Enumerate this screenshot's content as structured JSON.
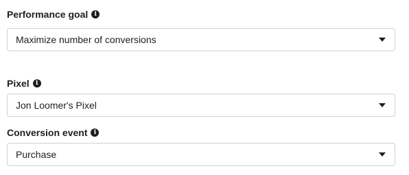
{
  "performance_goal": {
    "label": "Performance goal",
    "selected": "Maximize number of conversions"
  },
  "pixel": {
    "label": "Pixel",
    "selected": "Jon Loomer's Pixel"
  },
  "conversion_event": {
    "label": "Conversion event",
    "selected": "Purchase"
  },
  "icons": {
    "info": "info-icon",
    "dropdown": "chevron-down-icon"
  },
  "colors": {
    "text": "#1c1e21",
    "border": "#ccd0d5"
  }
}
